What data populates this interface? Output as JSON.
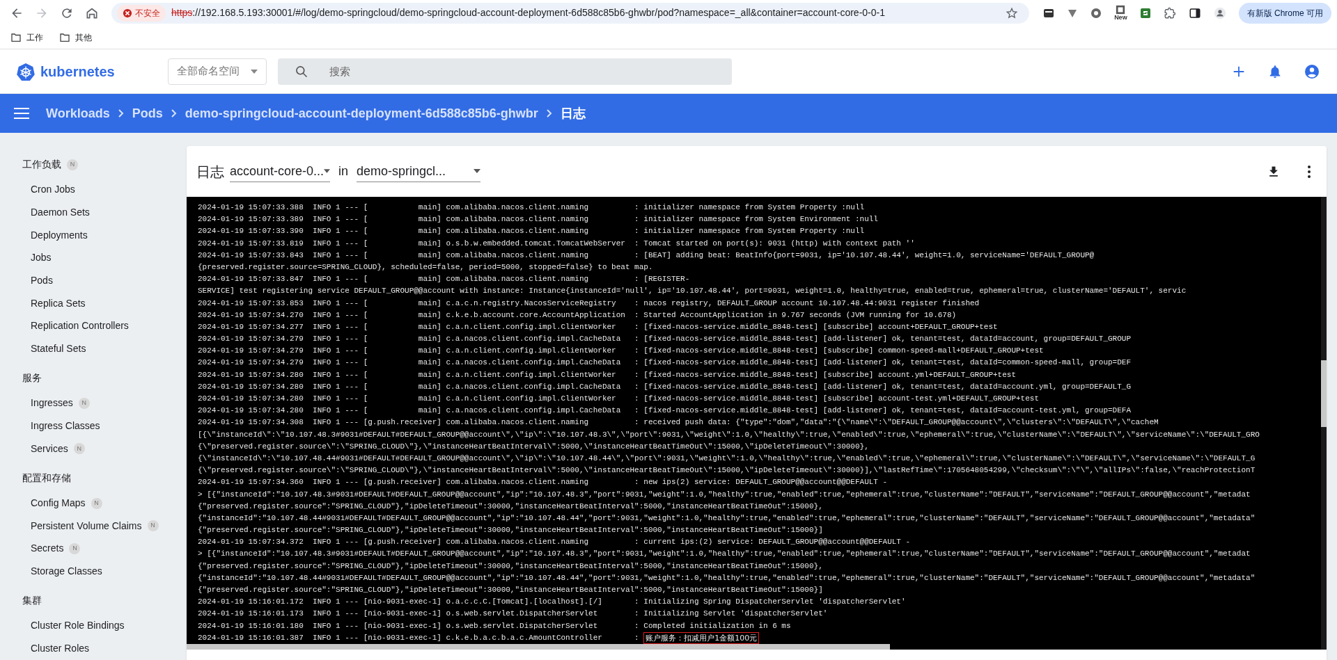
{
  "browser": {
    "security_label": "不安全",
    "url_scheme": "https",
    "url_rest": "://192.168.5.193:30001/#/log/demo-springcloud/demo-springcloud-account-deployment-6d588c85b6-ghwbr/pod?namespace=_all&container=account-core-0-0-1",
    "new_badge": "New",
    "update_button": "有新版 Chrome 可用",
    "bookmarks": [
      "工作",
      "其他"
    ]
  },
  "header": {
    "logo_text": "kubernetes",
    "namespace_select": "全部命名空间",
    "search": {
      "placeholder": "搜索"
    }
  },
  "breadcrumbs": [
    "Workloads",
    "Pods",
    "demo-springcloud-account-deployment-6d588c85b6-ghwbr",
    "日志"
  ],
  "sidebar": {
    "groups": [
      {
        "title": "工作负载",
        "badge": "N",
        "items": [
          {
            "label": "Cron Jobs"
          },
          {
            "label": "Daemon Sets"
          },
          {
            "label": "Deployments"
          },
          {
            "label": "Jobs"
          },
          {
            "label": "Pods"
          },
          {
            "label": "Replica Sets"
          },
          {
            "label": "Replication Controllers"
          },
          {
            "label": "Stateful Sets"
          }
        ]
      },
      {
        "title": "服务",
        "items": [
          {
            "label": "Ingresses",
            "badge": "N"
          },
          {
            "label": "Ingress Classes"
          },
          {
            "label": "Services",
            "badge": "N"
          }
        ]
      },
      {
        "title": "配置和存储",
        "items": [
          {
            "label": "Config Maps",
            "badge": "N"
          },
          {
            "label": "Persistent Volume Claims",
            "badge": "N"
          },
          {
            "label": "Secrets",
            "badge": "N"
          },
          {
            "label": "Storage Classes"
          }
        ]
      },
      {
        "title": "集群",
        "items": [
          {
            "label": "Cluster Role Bindings"
          },
          {
            "label": "Cluster Roles"
          }
        ]
      }
    ]
  },
  "log_panel": {
    "title": "日志",
    "container_select": "account-core-0...",
    "in_label": "in",
    "pod_select": "demo-springcl...",
    "lines": [
      {
        "text": "2024-01-19 15:07:33.388  INFO 1 --- [           main] com.alibaba.nacos.client.naming          : initializer namespace from System Property :null"
      },
      {
        "text": "2024-01-19 15:07:33.389  INFO 1 --- [           main] com.alibaba.nacos.client.naming          : initializer namespace from System Environment :null"
      },
      {
        "text": "2024-01-19 15:07:33.390  INFO 1 --- [           main] com.alibaba.nacos.client.naming          : initializer namespace from System Property :null"
      },
      {
        "text": "2024-01-19 15:07:33.819  INFO 1 --- [           main] o.s.b.w.embedded.tomcat.TomcatWebServer  : Tomcat started on port(s): 9031 (http) with context path ''"
      },
      {
        "text": "2024-01-19 15:07:33.843  INFO 1 --- [           main] com.alibaba.nacos.client.naming          : [BEAT] adding beat: BeatInfo{port=9031, ip='10.107.48.44', weight=1.0, serviceName='DEFAULT_GROUP@"
      },
      {
        "text": "{preserved.register.source=SPRING_CLOUD}, scheduled=false, period=5000, stopped=false} to beat map."
      },
      {
        "text": "2024-01-19 15:07:33.847  INFO 1 --- [           main] com.alibaba.nacos.client.naming          : [REGISTER-"
      },
      {
        "text": "SERVICE] test registering service DEFAULT_GROUP@@account with instance: Instance{instanceId='null', ip='10.107.48.44', port=9031, weight=1.0, healthy=true, enabled=true, ephemeral=true, clusterName='DEFAULT', servic"
      },
      {
        "text": "2024-01-19 15:07:33.853  INFO 1 --- [           main] c.a.c.n.registry.NacosServiceRegistry    : nacos registry, DEFAULT_GROUP account 10.107.48.44:9031 register finished"
      },
      {
        "text": "2024-01-19 15:07:34.270  INFO 1 --- [           main] c.k.e.b.account.core.AccountApplication  : Started AccountApplication in 9.767 seconds (JVM running for 10.678)"
      },
      {
        "text": "2024-01-19 15:07:34.277  INFO 1 --- [           main] c.a.n.client.config.impl.ClientWorker    : [fixed-nacos-service.middle_8848-test] [subscribe] account+DEFAULT_GROUP+test"
      },
      {
        "text": "2024-01-19 15:07:34.279  INFO 1 --- [           main] c.a.nacos.client.config.impl.CacheData   : [fixed-nacos-service.middle_8848-test] [add-listener] ok, tenant=test, dataId=account, group=DEFAULT_GROUP"
      },
      {
        "text": "2024-01-19 15:07:34.279  INFO 1 --- [           main] c.a.n.client.config.impl.ClientWorker    : [fixed-nacos-service.middle_8848-test] [subscribe] common-speed-mall+DEFAULT_GROUP+test"
      },
      {
        "text": "2024-01-19 15:07:34.279  INFO 1 --- [           main] c.a.nacos.client.config.impl.CacheData   : [fixed-nacos-service.middle_8848-test] [add-listener] ok, tenant=test, dataId=common-speed-mall, group=DEF"
      },
      {
        "text": "2024-01-19 15:07:34.280  INFO 1 --- [           main] c.a.n.client.config.impl.ClientWorker    : [fixed-nacos-service.middle_8848-test] [subscribe] account.yml+DEFAULT_GROUP+test"
      },
      {
        "text": "2024-01-19 15:07:34.280  INFO 1 --- [           main] c.a.nacos.client.config.impl.CacheData   : [fixed-nacos-service.middle_8848-test] [add-listener] ok, tenant=test, dataId=account.yml, group=DEFAULT_G"
      },
      {
        "text": "2024-01-19 15:07:34.280  INFO 1 --- [           main] c.a.n.client.config.impl.ClientWorker    : [fixed-nacos-service.middle_8848-test] [subscribe] account-test.yml+DEFAULT_GROUP+test"
      },
      {
        "text": "2024-01-19 15:07:34.280  INFO 1 --- [           main] c.a.nacos.client.config.impl.CacheData   : [fixed-nacos-service.middle_8848-test] [add-listener] ok, tenant=test, dataId=account-test.yml, group=DEFA"
      },
      {
        "text": "2024-01-19 15:07:34.308  INFO 1 --- [g.push.receiver] com.alibaba.nacos.client.naming          : received push data: {\"type\":\"dom\",\"data\":\"{\\\"name\\\":\\\"DEFAULT_GROUP@@account\\\",\\\"clusters\\\":\\\"DEFAULT\\\",\\\"cacheM"
      },
      {
        "text": "[{\\\"instanceId\\\":\\\"10.107.48.3#9031#DEFAULT#DEFAULT_GROUP@@account\\\",\\\"ip\\\":\\\"10.107.48.3\\\",\\\"port\\\":9031,\\\"weight\\\":1.0,\\\"healthy\\\":true,\\\"enabled\\\":true,\\\"ephemeral\\\":true,\\\"clusterName\\\":\\\"DEFAULT\\\",\\\"serviceName\\\":\\\"DEFAULT_GRO"
      },
      {
        "text": "{\\\"preserved.register.source\\\":\\\"SPRING_CLOUD\\\"},\\\"instanceHeartBeatInterval\\\":5000,\\\"instanceHeartBeatTimeOut\\\":15000,\\\"ipDeleteTimeout\\\":30000},"
      },
      {
        "text": "{\\\"instanceId\\\":\\\"10.107.48.44#9031#DEFAULT#DEFAULT_GROUP@@account\\\",\\\"ip\\\":\\\"10.107.48.44\\\",\\\"port\\\":9031,\\\"weight\\\":1.0,\\\"healthy\\\":true,\\\"enabled\\\":true,\\\"ephemeral\\\":true,\\\"clusterName\\\":\\\"DEFAULT\\\",\\\"serviceName\\\":\\\"DEFAULT_G"
      },
      {
        "text": "{\\\"preserved.register.source\\\":\\\"SPRING_CLOUD\\\"},\\\"instanceHeartBeatInterval\\\":5000,\\\"instanceHeartBeatTimeOut\\\":15000,\\\"ipDeleteTimeout\\\":30000}],\\\"lastRefTime\\\":1705648054299,\\\"checksum\\\":\\\"\\\",\\\"allIPs\\\":false,\\\"reachProtectionT"
      },
      {
        "text": "2024-01-19 15:07:34.360  INFO 1 --- [g.push.receiver] com.alibaba.nacos.client.naming          : new ips(2) service: DEFAULT_GROUP@@account@@DEFAULT -"
      },
      {
        "text": "> [{\"instanceId\":\"10.107.48.3#9031#DEFAULT#DEFAULT_GROUP@@account\",\"ip\":\"10.107.48.3\",\"port\":9031,\"weight\":1.0,\"healthy\":true,\"enabled\":true,\"ephemeral\":true,\"clusterName\":\"DEFAULT\",\"serviceName\":\"DEFAULT_GROUP@@account\",\"metadat"
      },
      {
        "text": "{\"preserved.register.source\":\"SPRING_CLOUD\"},\"ipDeleteTimeout\":30000,\"instanceHeartBeatInterval\":5000,\"instanceHeartBeatTimeOut\":15000},"
      },
      {
        "text": "{\"instanceId\":\"10.107.48.44#9031#DEFAULT#DEFAULT_GROUP@@account\",\"ip\":\"10.107.48.44\",\"port\":9031,\"weight\":1.0,\"healthy\":true,\"enabled\":true,\"ephemeral\":true,\"clusterName\":\"DEFAULT\",\"serviceName\":\"DEFAULT_GROUP@@account\",\"metadata\""
      },
      {
        "text": "{\"preserved.register.source\":\"SPRING_CLOUD\"},\"ipDeleteTimeout\":30000,\"instanceHeartBeatInterval\":5000,\"instanceHeartBeatTimeOut\":15000}]"
      },
      {
        "text": "2024-01-19 15:07:34.372  INFO 1 --- [g.push.receiver] com.alibaba.nacos.client.naming          : current ips:(2) service: DEFAULT_GROUP@@account@@DEFAULT -"
      },
      {
        "text": "> [{\"instanceId\":\"10.107.48.3#9031#DEFAULT#DEFAULT_GROUP@@account\",\"ip\":\"10.107.48.3\",\"port\":9031,\"weight\":1.0,\"healthy\":true,\"enabled\":true,\"ephemeral\":true,\"clusterName\":\"DEFAULT\",\"serviceName\":\"DEFAULT_GROUP@@account\",\"metadat"
      },
      {
        "text": "{\"preserved.register.source\":\"SPRING_CLOUD\"},\"ipDeleteTimeout\":30000,\"instanceHeartBeatInterval\":5000,\"instanceHeartBeatTimeOut\":15000},"
      },
      {
        "text": "{\"instanceId\":\"10.107.48.44#9031#DEFAULT#DEFAULT_GROUP@@account\",\"ip\":\"10.107.48.44\",\"port\":9031,\"weight\":1.0,\"healthy\":true,\"enabled\":true,\"ephemeral\":true,\"clusterName\":\"DEFAULT\",\"serviceName\":\"DEFAULT_GROUP@@account\",\"metadata\""
      },
      {
        "text": "{\"preserved.register.source\":\"SPRING_CLOUD\"},\"ipDeleteTimeout\":30000,\"instanceHeartBeatInterval\":5000,\"instanceHeartBeatTimeOut\":15000}]"
      },
      {
        "text": "2024-01-19 15:16:01.172  INFO 1 --- [nio-9031-exec-1] o.a.c.c.C.[Tomcat].[localhost].[/]       : Initializing Spring DispatcherServlet 'dispatcherServlet'"
      },
      {
        "text": "2024-01-19 15:16:01.173  INFO 1 --- [nio-9031-exec-1] o.s.web.servlet.DispatcherServlet        : Initializing Servlet 'dispatcherServlet'"
      },
      {
        "text": "2024-01-19 15:16:01.180  INFO 1 --- [nio-9031-exec-1] o.s.web.servlet.DispatcherServlet        : Completed initialization in 6 ms"
      },
      {
        "text": "2024-01-19 15:16:01.387  INFO 1 --- [nio-9031-exec-1] c.k.e.b.a.c.b.a.c.AmountController       : ",
        "highlighted_text": "账户服务：扣减用户1金额100元"
      }
    ]
  }
}
